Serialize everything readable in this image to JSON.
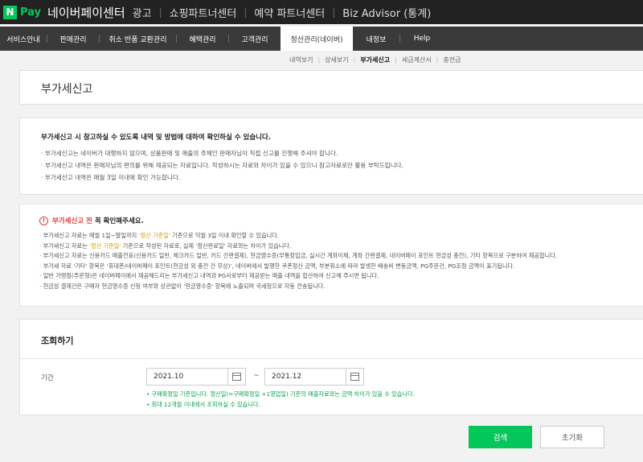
{
  "topbar": {
    "logo_letter": "N",
    "logo_pay": "Pay",
    "title": "네이버페이센터",
    "links": [
      "광고",
      "쇼핑파트너센터",
      "예약 파트너센터",
      "Biz Advisor (통계)"
    ]
  },
  "mainnav": {
    "items": [
      "서비스안내",
      "판매관리",
      "취소 반품 교환관리",
      "혜택관리",
      "고객관리",
      "정산관리(네이버)",
      "내정보",
      "Help"
    ],
    "active_index": 5
  },
  "subnav": {
    "items": [
      "내역보기",
      "상세보기",
      "부가세신고",
      "세금계산서",
      "충전금"
    ],
    "active_index": 2
  },
  "page": {
    "title": "부가세신고"
  },
  "info1": {
    "headline": "부가세신고 시 참고하실 수 있도록 내역 및 방법에 대하여 확인하실 수 있습니다.",
    "bullets": [
      "· 부가세신고는 네이버가 대행하지 않으며, 상품판매 및 매출의 주체인 판매자님이 직접 신고를 진행해 주셔야 합니다.",
      "· 부가세신고 내역은 판매자님의 편의를 위해 제공되는 자료입니다. 작성하시는 자료와 차이가 있을 수 있으니 참고자료로만 활용 부탁드립니다.",
      "· 부가세신고 내역은 매월 3일 이내에 확인 가능합니다."
    ]
  },
  "info2": {
    "warn_icon": "!",
    "warn_red": "부가세신고 전",
    "warn_black": "꼭 확인해주세요.",
    "b1_pre": "· 부가세신고 자료는 매월 1일~말일까지 ",
    "b1_hl": "'정산 기준일'",
    "b1_post": " 기준으로 익월 3일 이내 확인할 수 있습니다.",
    "b2_pre": "· 부가세신고 자료는 ",
    "b2_hl": "'정산 기준일'",
    "b2_post": " 기준으로 작성된 자료로, 실제 '정산완료일' 자료와는 차이가 있습니다.",
    "bullets": [
      "· 부가세신고 자료는 신용카드 매출전표(신용카드 일반, 체크카드 일반, 카드 간편결제), 현금영수증(무통장입금, 실시간 계좌이체, 계좌 간편결제, 네이버페이 포인트 현금성 충전), 기타 항목으로 구분하여 제공합니다.",
      "· 부가세 자료 '기타' 항목은 '휴대폰/네이버페이 포인트(현금성 외 충전 건 무상)', 네이버에서 발행한 쿠폰정산 금액, 부분취소에 따라 발생한 배송비 변동금액, PG주문건, PG조정 금액이 표기됩니다.",
      "· 일반 가맹점(주문형)은 네이버페이에서 제공해드리는 부가세신고 내역과 PG사로부터 제공받는 매출 내역을 합산하여 신고해 주시면 됩니다.",
      "· 현금성 결제건은 구매자 현금영수증 신청 여부와 상관없이 '현금영수증' 항목에 노출되며 국세청으로 자동 전송됩니다."
    ]
  },
  "search": {
    "title": "조회하기",
    "period_label": "기간",
    "start_date": "2021.10",
    "end_date": "2021.12",
    "tilde": "~",
    "notes": [
      "• 구매확정일 기준입니다. 정산일(=구매확정일 +1영업일) 기준의 매출자료와는 금액 차이가 있을 수 있습니다.",
      "• 최대 12개월 이내에서 조회하실 수 있습니다."
    ],
    "search_button": "검색",
    "reset_button": "초기화"
  }
}
